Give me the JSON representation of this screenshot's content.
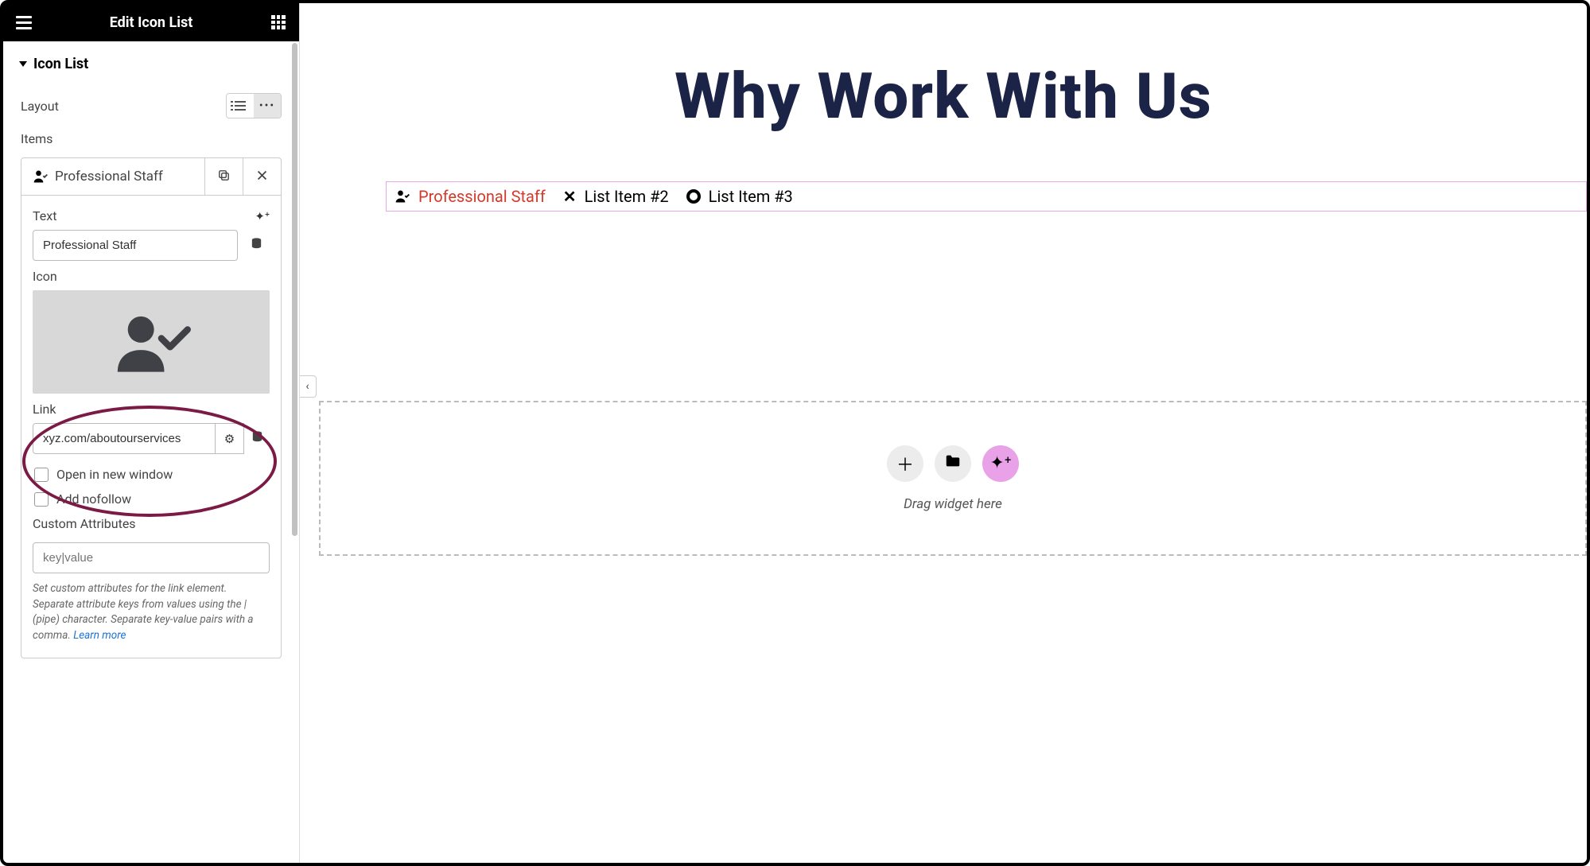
{
  "sidebar": {
    "title": "Edit Icon List",
    "section": "Icon List",
    "layout_label": "Layout",
    "items_label": "Items",
    "item": {
      "header_label": "Professional Staff",
      "text_label": "Text",
      "text_value": "Professional Staff",
      "icon_label": "Icon",
      "link_label": "Link",
      "link_value": "xyz.com/aboutourservices",
      "open_new_window": "Open in new window",
      "add_nofollow": "Add nofollow",
      "custom_attr_label": "Custom Attributes",
      "custom_attr_placeholder": "key|value",
      "help_text": "Set custom attributes for the link element. Separate attribute keys from values using the | (pipe) character. Separate key-value pairs with a comma. ",
      "learn_more": "Learn more"
    }
  },
  "canvas": {
    "hero": "Why Work With Us",
    "list": [
      {
        "label": "Professional Staff",
        "highlighted": true
      },
      {
        "label": "List Item #2"
      },
      {
        "label": "List Item #3"
      }
    ],
    "dropzone_label": "Drag widget here"
  }
}
